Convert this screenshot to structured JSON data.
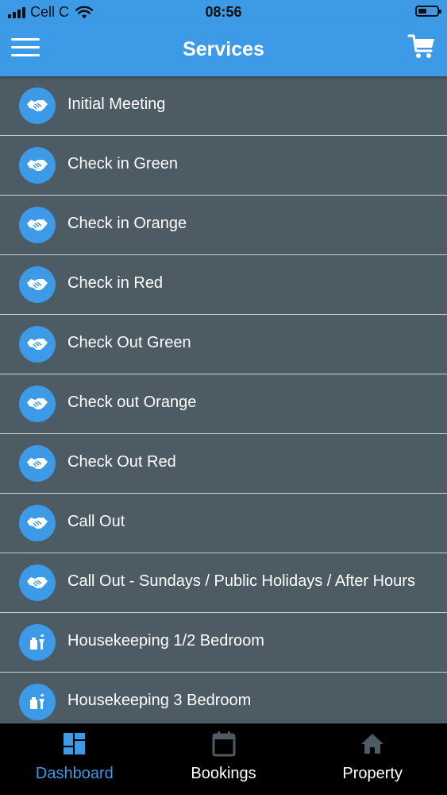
{
  "status_bar": {
    "carrier": "Cell C",
    "time": "08:56"
  },
  "header": {
    "title": "Services"
  },
  "services": [
    {
      "label": "Initial Meeting",
      "icon": "handshake-icon"
    },
    {
      "label": "Check in Green",
      "icon": "handshake-icon"
    },
    {
      "label": "Check in Orange",
      "icon": "handshake-icon"
    },
    {
      "label": "Check in Red",
      "icon": "handshake-icon"
    },
    {
      "label": "Check Out Green",
      "icon": "handshake-icon"
    },
    {
      "label": "Check out Orange",
      "icon": "handshake-icon"
    },
    {
      "label": "Check Out Red",
      "icon": "handshake-icon"
    },
    {
      "label": "Call Out",
      "icon": "handshake-icon"
    },
    {
      "label": "Call Out - Sundays / Public Holidays / After Hours",
      "icon": "handshake-icon"
    },
    {
      "label": "Housekeeping 1/2 Bedroom",
      "icon": "cleaning-supplies-icon"
    },
    {
      "label": "Housekeeping 3 Bedroom",
      "icon": "cleaning-supplies-icon"
    }
  ],
  "tabs": [
    {
      "label": "Dashboard",
      "icon": "dashboard-icon",
      "active": true
    },
    {
      "label": "Bookings",
      "icon": "calendar-icon",
      "active": false
    },
    {
      "label": "Property",
      "icon": "home-icon",
      "active": false
    }
  ],
  "colors": {
    "accent": "#3d9ae6",
    "list_background": "#4c5b64",
    "tab_bar": "#000000",
    "text": "#ffffff"
  }
}
